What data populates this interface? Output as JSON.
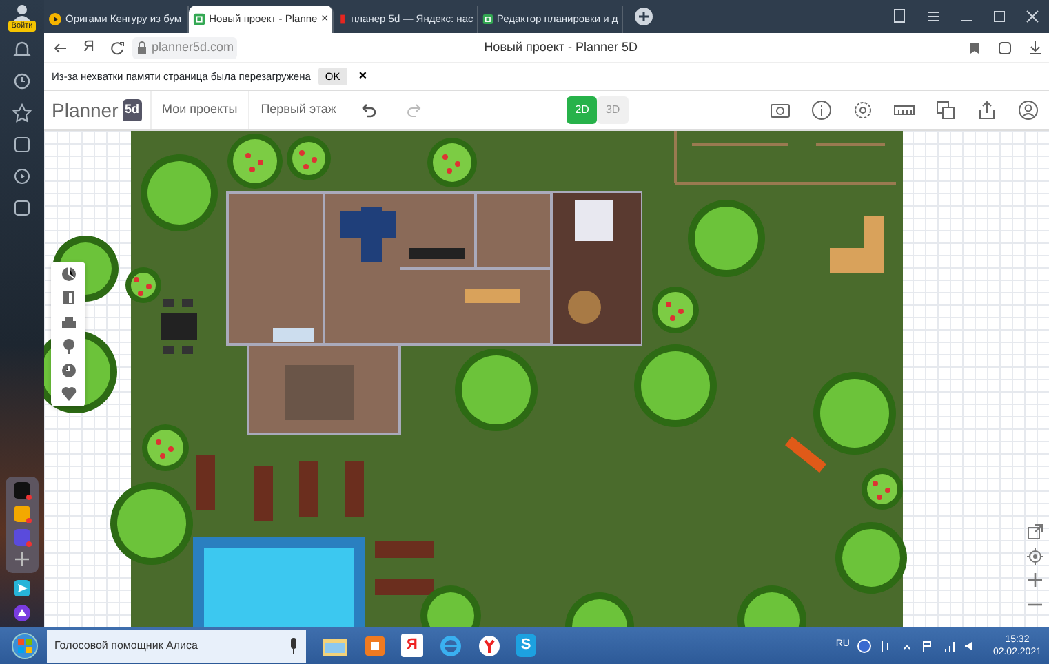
{
  "browser": {
    "profile_label": "Войти",
    "tabs": [
      {
        "kind": "video",
        "title": "Оригами Кенгуру из бум",
        "selected": false
      },
      {
        "kind": "planner",
        "title": "Новый проект - Planne",
        "selected": true,
        "close": "×"
      },
      {
        "kind": "yandex",
        "title": "планер 5d — Яндекс: нас",
        "selected": false
      },
      {
        "kind": "planner",
        "title": "Редактор планировки и д",
        "selected": false
      }
    ],
    "address": "planner5d.com",
    "page_title": "Новый проект - Planner 5D",
    "yandex_mark": "Я"
  },
  "notification": {
    "text": "Из-за нехватки памяти страница была перезагружена",
    "button": "OK",
    "close": "×"
  },
  "app_toolbar": {
    "logo": "Planner",
    "logo_badge": "5d",
    "menu": [
      "Мои проекты",
      "Первый этаж"
    ],
    "view_modes": [
      {
        "label": "2D",
        "selected": true
      },
      {
        "label": "3D",
        "selected": false
      }
    ]
  },
  "taskbar": {
    "search": "Голосовой помощник Алиса",
    "yandex_mark": "Я",
    "skype_mark": "S",
    "language": "RU",
    "time": "15:32",
    "date": "02.02.2021"
  }
}
